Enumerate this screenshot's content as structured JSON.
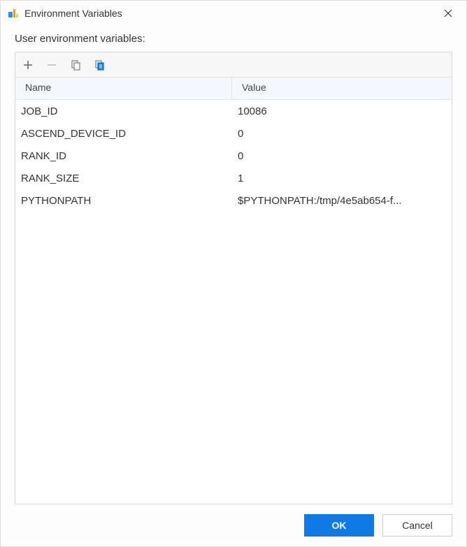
{
  "dialog": {
    "title": "Environment Variables"
  },
  "section": {
    "label": "User environment variables:"
  },
  "table": {
    "columns": {
      "name": "Name",
      "value": "Value"
    },
    "rows": [
      {
        "name": "JOB_ID",
        "value": "10086"
      },
      {
        "name": "ASCEND_DEVICE_ID",
        "value": "0"
      },
      {
        "name": "RANK_ID",
        "value": "0"
      },
      {
        "name": "RANK_SIZE",
        "value": "1"
      },
      {
        "name": "PYTHONPATH",
        "value": "$PYTHONPATH:/tmp/4e5ab654-f..."
      }
    ]
  },
  "footer": {
    "ok": "OK",
    "cancel": "Cancel"
  }
}
